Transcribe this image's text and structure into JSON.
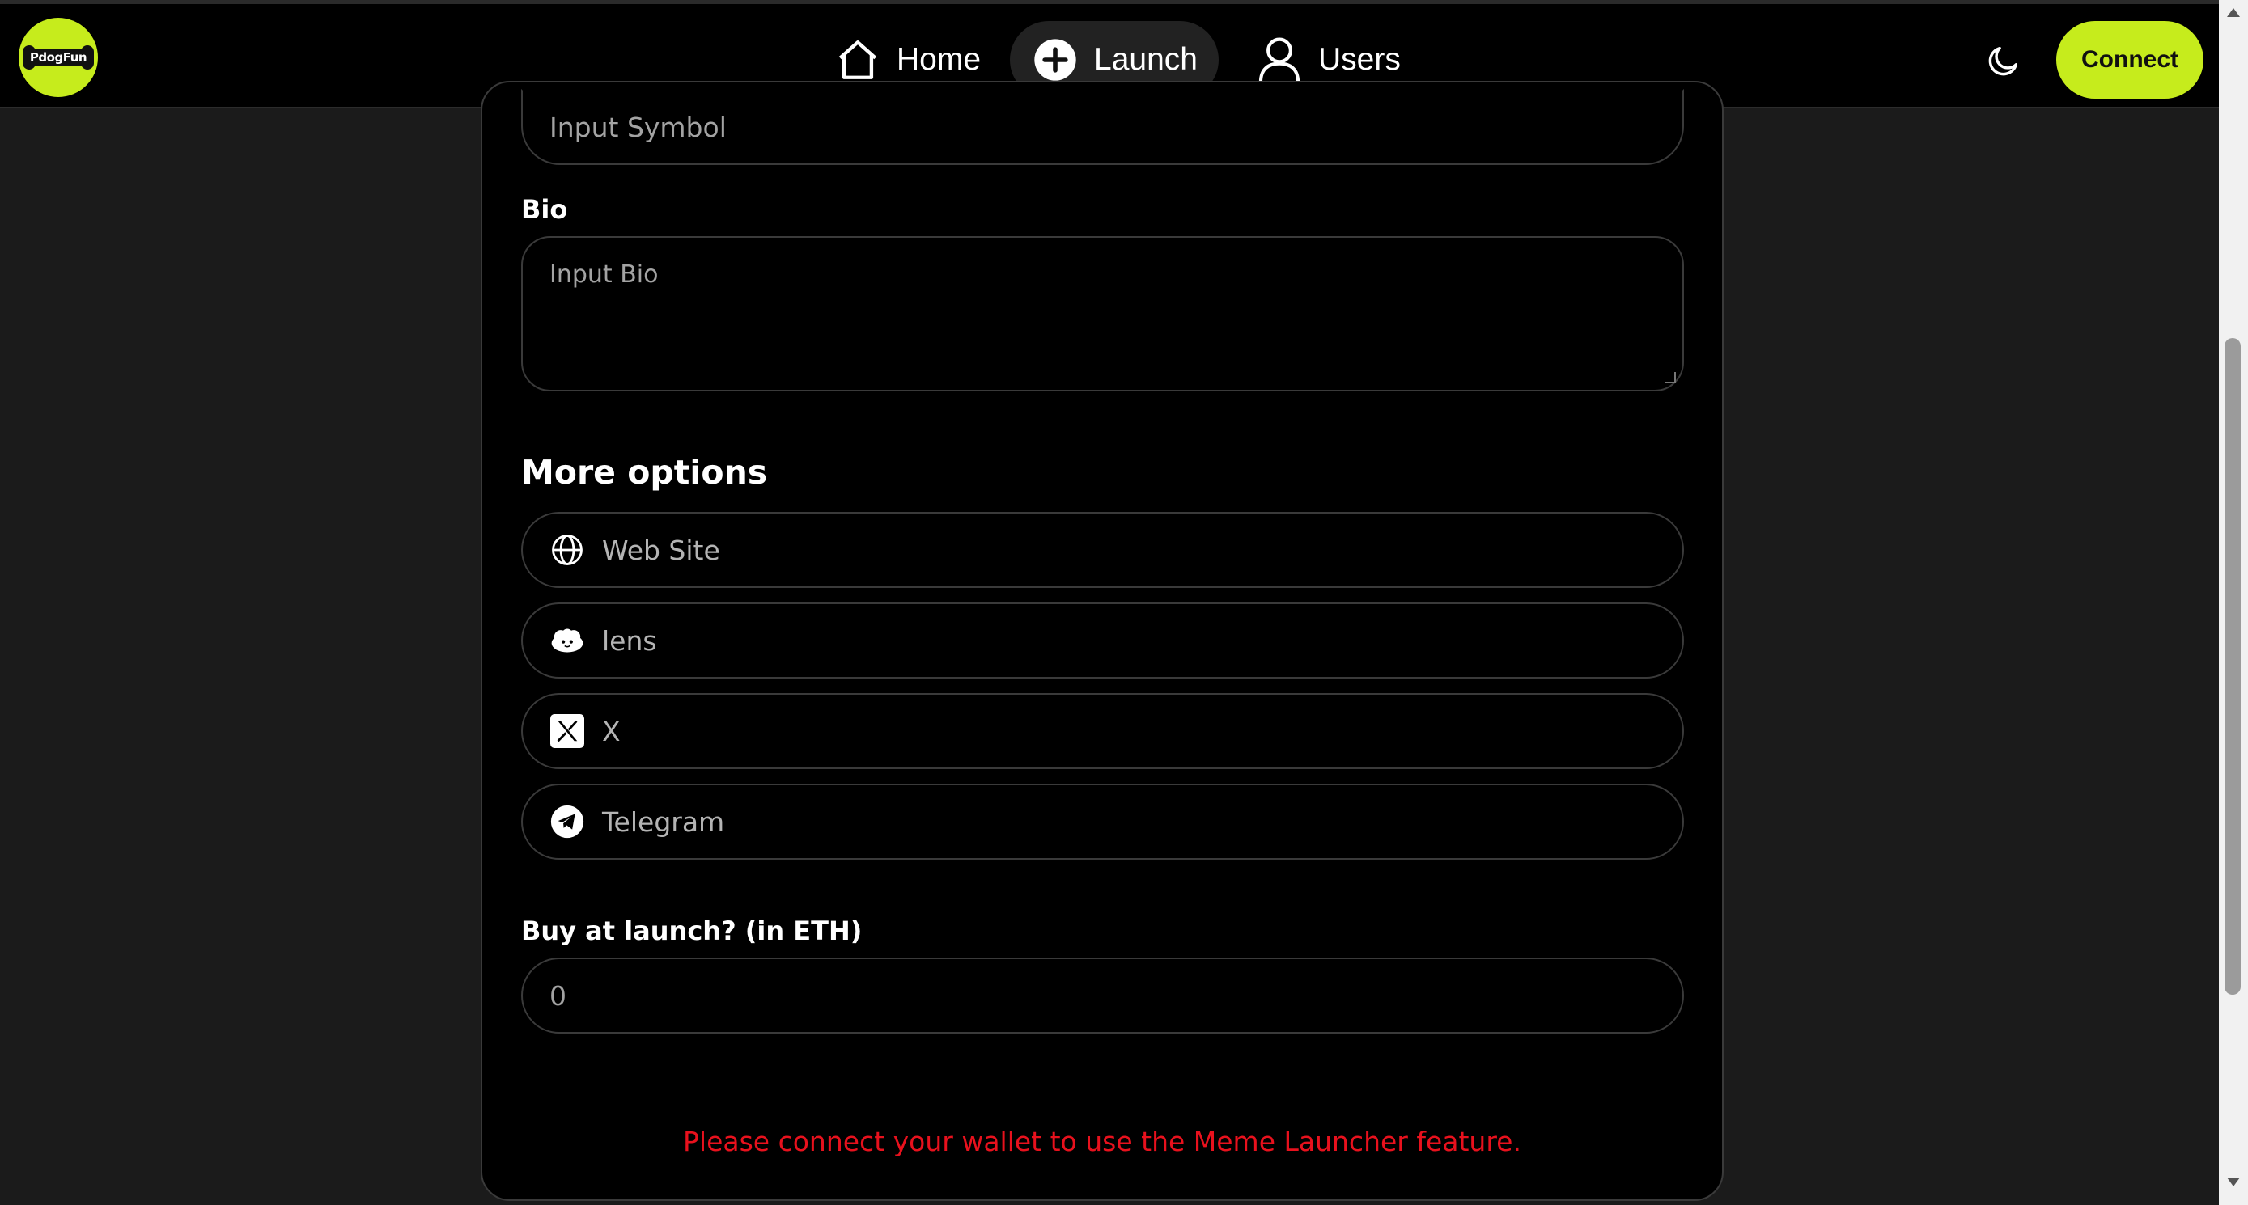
{
  "navbar": {
    "logo_text": "PdogFun",
    "items": [
      {
        "label": "Home",
        "icon": "home-icon"
      },
      {
        "label": "Launch",
        "icon": "plus-circle-icon"
      },
      {
        "label": "Users",
        "icon": "user-icon"
      }
    ],
    "connect_label": "Connect",
    "theme_icon": "moon-icon",
    "accent_color": "#c6ec1c"
  },
  "form": {
    "symbol_placeholder": "Input Symbol",
    "bio_label": "Bio",
    "bio_placeholder": "Input Bio",
    "more_options_title": "More options",
    "options": [
      {
        "placeholder": "Web Site",
        "icon": "globe-icon"
      },
      {
        "placeholder": "lens",
        "icon": "lens-icon"
      },
      {
        "placeholder": "X",
        "icon": "x-icon"
      },
      {
        "placeholder": "Telegram",
        "icon": "telegram-icon"
      }
    ],
    "buy_label": "Buy at launch? (in ETH)",
    "buy_value": "0",
    "warning": "Please connect your wallet to use the Meme Launcher feature.",
    "warning_color": "#e8111d"
  }
}
